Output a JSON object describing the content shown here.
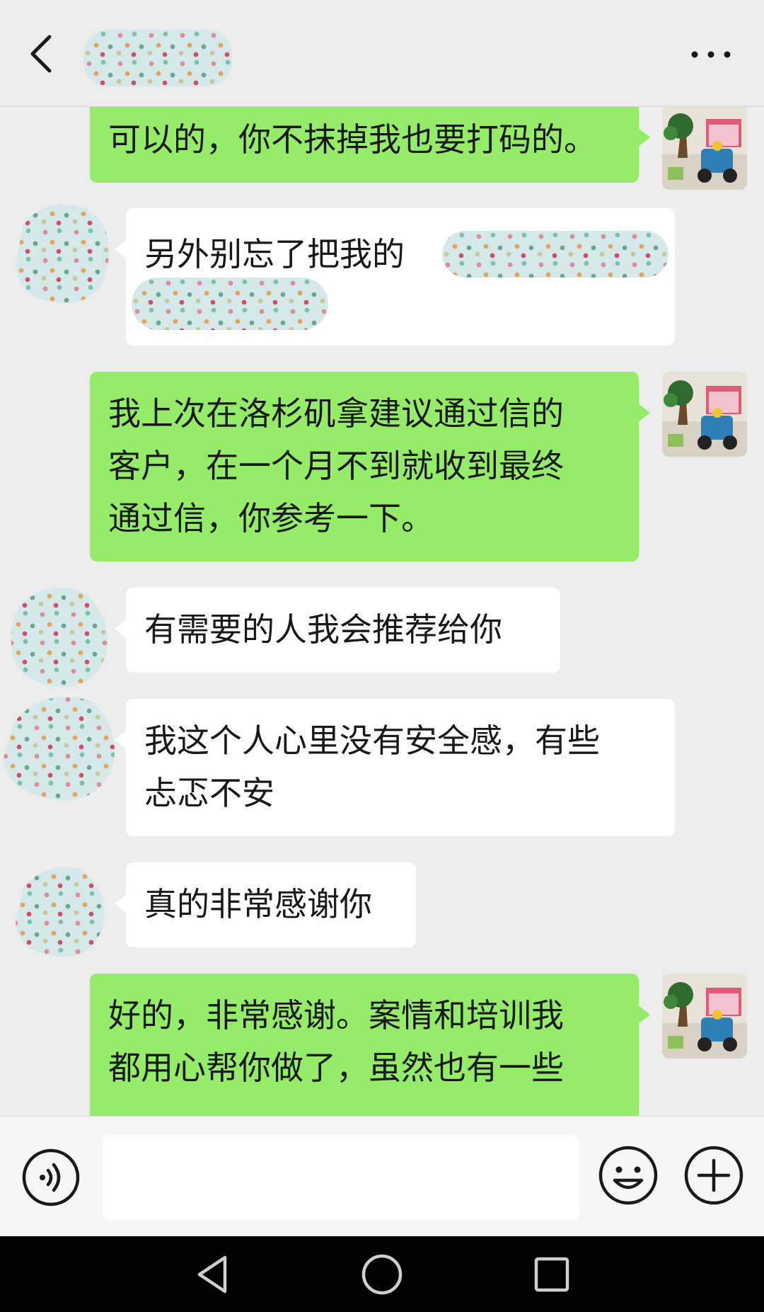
{
  "header": {
    "back_icon": "chevron-left-icon",
    "contact_name_redacted": true,
    "more_icon": "more-dots-icon"
  },
  "messages": [
    {
      "side": "right",
      "text": "可以的，你不抹掉我也要打码的。"
    },
    {
      "side": "left",
      "text_visible": "另外别忘了把我的",
      "redacted": true
    },
    {
      "side": "right",
      "text_lines": [
        "我上次在洛杉矶拿建议通过信的",
        "客户，在一个月不到就收到最终",
        "通过信，你参考一下。"
      ]
    },
    {
      "side": "left",
      "text": "有需要的人我会推荐给你"
    },
    {
      "side": "left",
      "text_lines": [
        "我这个人心里没有安全感，有些",
        "忐忑不安"
      ]
    },
    {
      "side": "left",
      "text": "真的非常感谢你"
    },
    {
      "side": "right",
      "text_lines": [
        "好的，非常感谢。案情和培训我",
        "都用心帮你做了，虽然也有一些"
      ]
    }
  ],
  "colors": {
    "background": "#ededed",
    "sent_bubble": "#95ec69",
    "received_bubble": "#ffffff",
    "navbar": "#000000"
  },
  "input_bar": {
    "voice_icon": "voice-icon",
    "emoji_icon": "emoji-icon",
    "plus_icon": "plus-icon",
    "text_value": ""
  },
  "nav": {
    "back_icon": "nav-back-triangle-icon",
    "home_icon": "nav-home-circle-icon",
    "recent_icon": "nav-recent-square-icon"
  }
}
